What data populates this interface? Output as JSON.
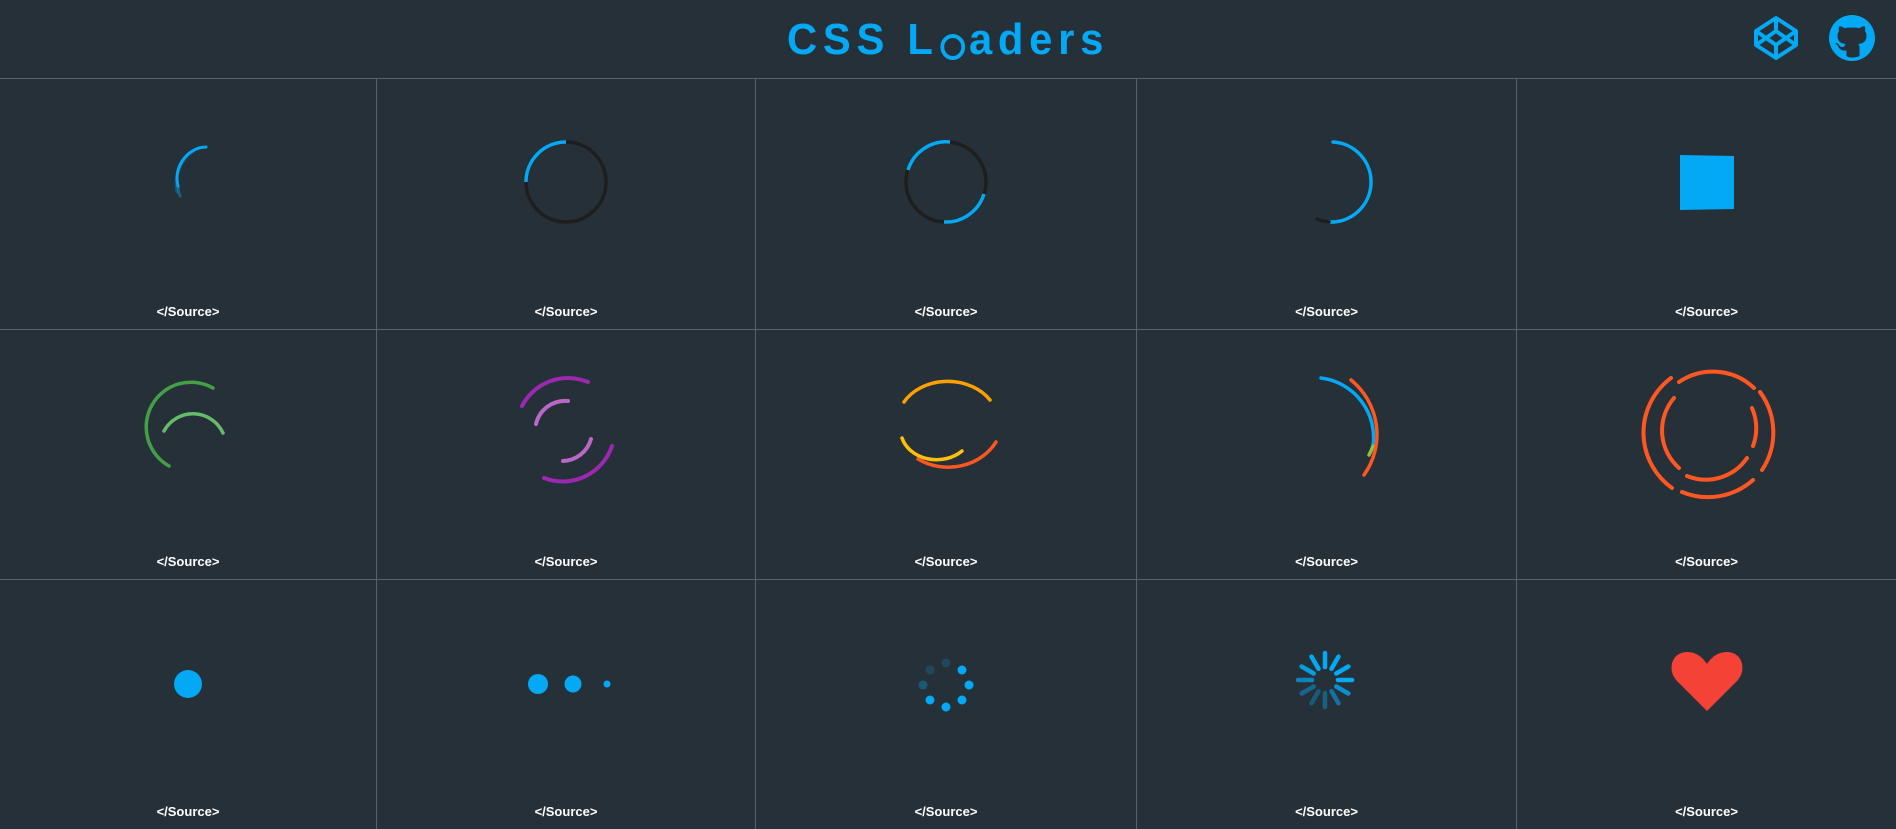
{
  "header": {
    "title_left": "CSS L",
    "title_right": "aders",
    "icons": [
      "codepen-icon",
      "github-icon"
    ]
  },
  "colors": {
    "background": "#263038",
    "accent": "#03a9f4",
    "border": "#5a6267",
    "green": "#43a047",
    "purple": "#9c27b0",
    "orange": "#ff5722",
    "amber": "#ffa000",
    "red": "#f44336"
  },
  "loaders": [
    {
      "name": "spinner-gradient-arc",
      "source_label": "</Source>"
    },
    {
      "name": "spinner-ring",
      "source_label": "</Source>"
    },
    {
      "name": "spinner-double-arc",
      "source_label": "</Source>"
    },
    {
      "name": "spinner-half-ring",
      "source_label": "</Source>"
    },
    {
      "name": "rotating-square",
      "source_label": "</Source>"
    },
    {
      "name": "spinner-green-arcs",
      "source_label": "</Source>"
    },
    {
      "name": "spinner-purple-arcs",
      "source_label": "</Source>"
    },
    {
      "name": "spinner-orange-arcs",
      "source_label": "</Source>"
    },
    {
      "name": "spinner-multicolor-arcs",
      "source_label": "</Source>"
    },
    {
      "name": "spinner-orange-rings",
      "source_label": "</Source>"
    },
    {
      "name": "pulse-dot",
      "source_label": "</Source>"
    },
    {
      "name": "three-dots",
      "source_label": "</Source>"
    },
    {
      "name": "dot-circle",
      "source_label": "</Source>"
    },
    {
      "name": "line-spinner",
      "source_label": "</Source>"
    },
    {
      "name": "heart",
      "source_label": "</Source>"
    }
  ]
}
